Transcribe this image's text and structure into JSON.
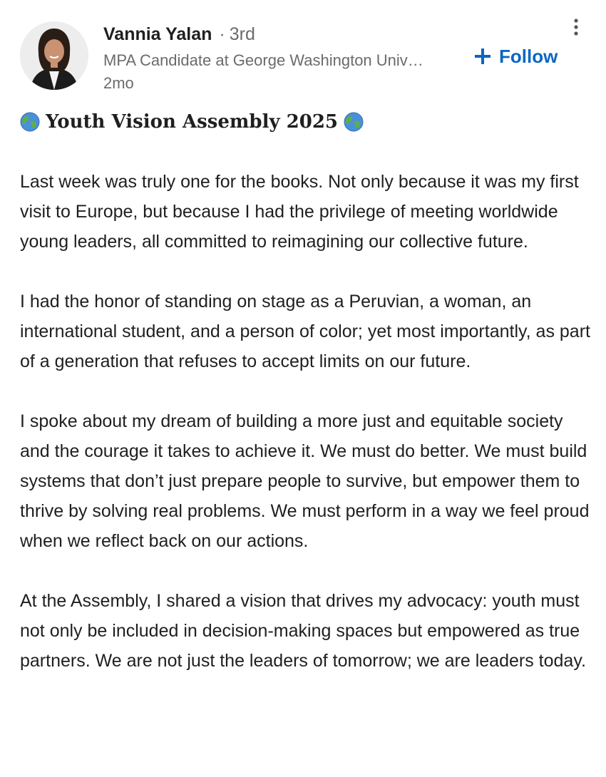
{
  "author": {
    "name": "Vannia Yalan",
    "separator": "·",
    "degree": "3rd",
    "headline": "MPA Candidate at George Washington University",
    "timestamp": "2mo",
    "avatar_icon": "profile-photo"
  },
  "actions": {
    "follow_label": "Follow",
    "follow_icon": "plus-icon",
    "more_icon": "vertical-ellipsis-icon",
    "accent_color": "#0a66c2"
  },
  "post": {
    "title": "Youth Vision Assembly 2025",
    "title_icon": "globe-icon",
    "paragraphs": [
      "Last week was truly one for the books. Not only because it was my first visit to Europe, but because I had the privilege of meeting worldwide young leaders, all committed to reimagining our collective future.",
      "I had the honor of standing on stage as a Peruvian, a woman, an international student, and a person of color; yet most importantly, as part of a generation that refuses to accept limits on our future.",
      "I spoke about my dream of building a more just and equitable society and the courage it takes to achieve it. We must do better. We must build systems that don’t just prepare people to survive, but empower them to thrive by solving real problems. We must perform in a way we feel proud when we reflect back on our actions.",
      "At the Assembly, I shared a vision that drives my advocacy: youth must not only be included in decision-making spaces but empowered as true partners. We are not just the leaders of tomorrow; we are leaders today."
    ]
  }
}
